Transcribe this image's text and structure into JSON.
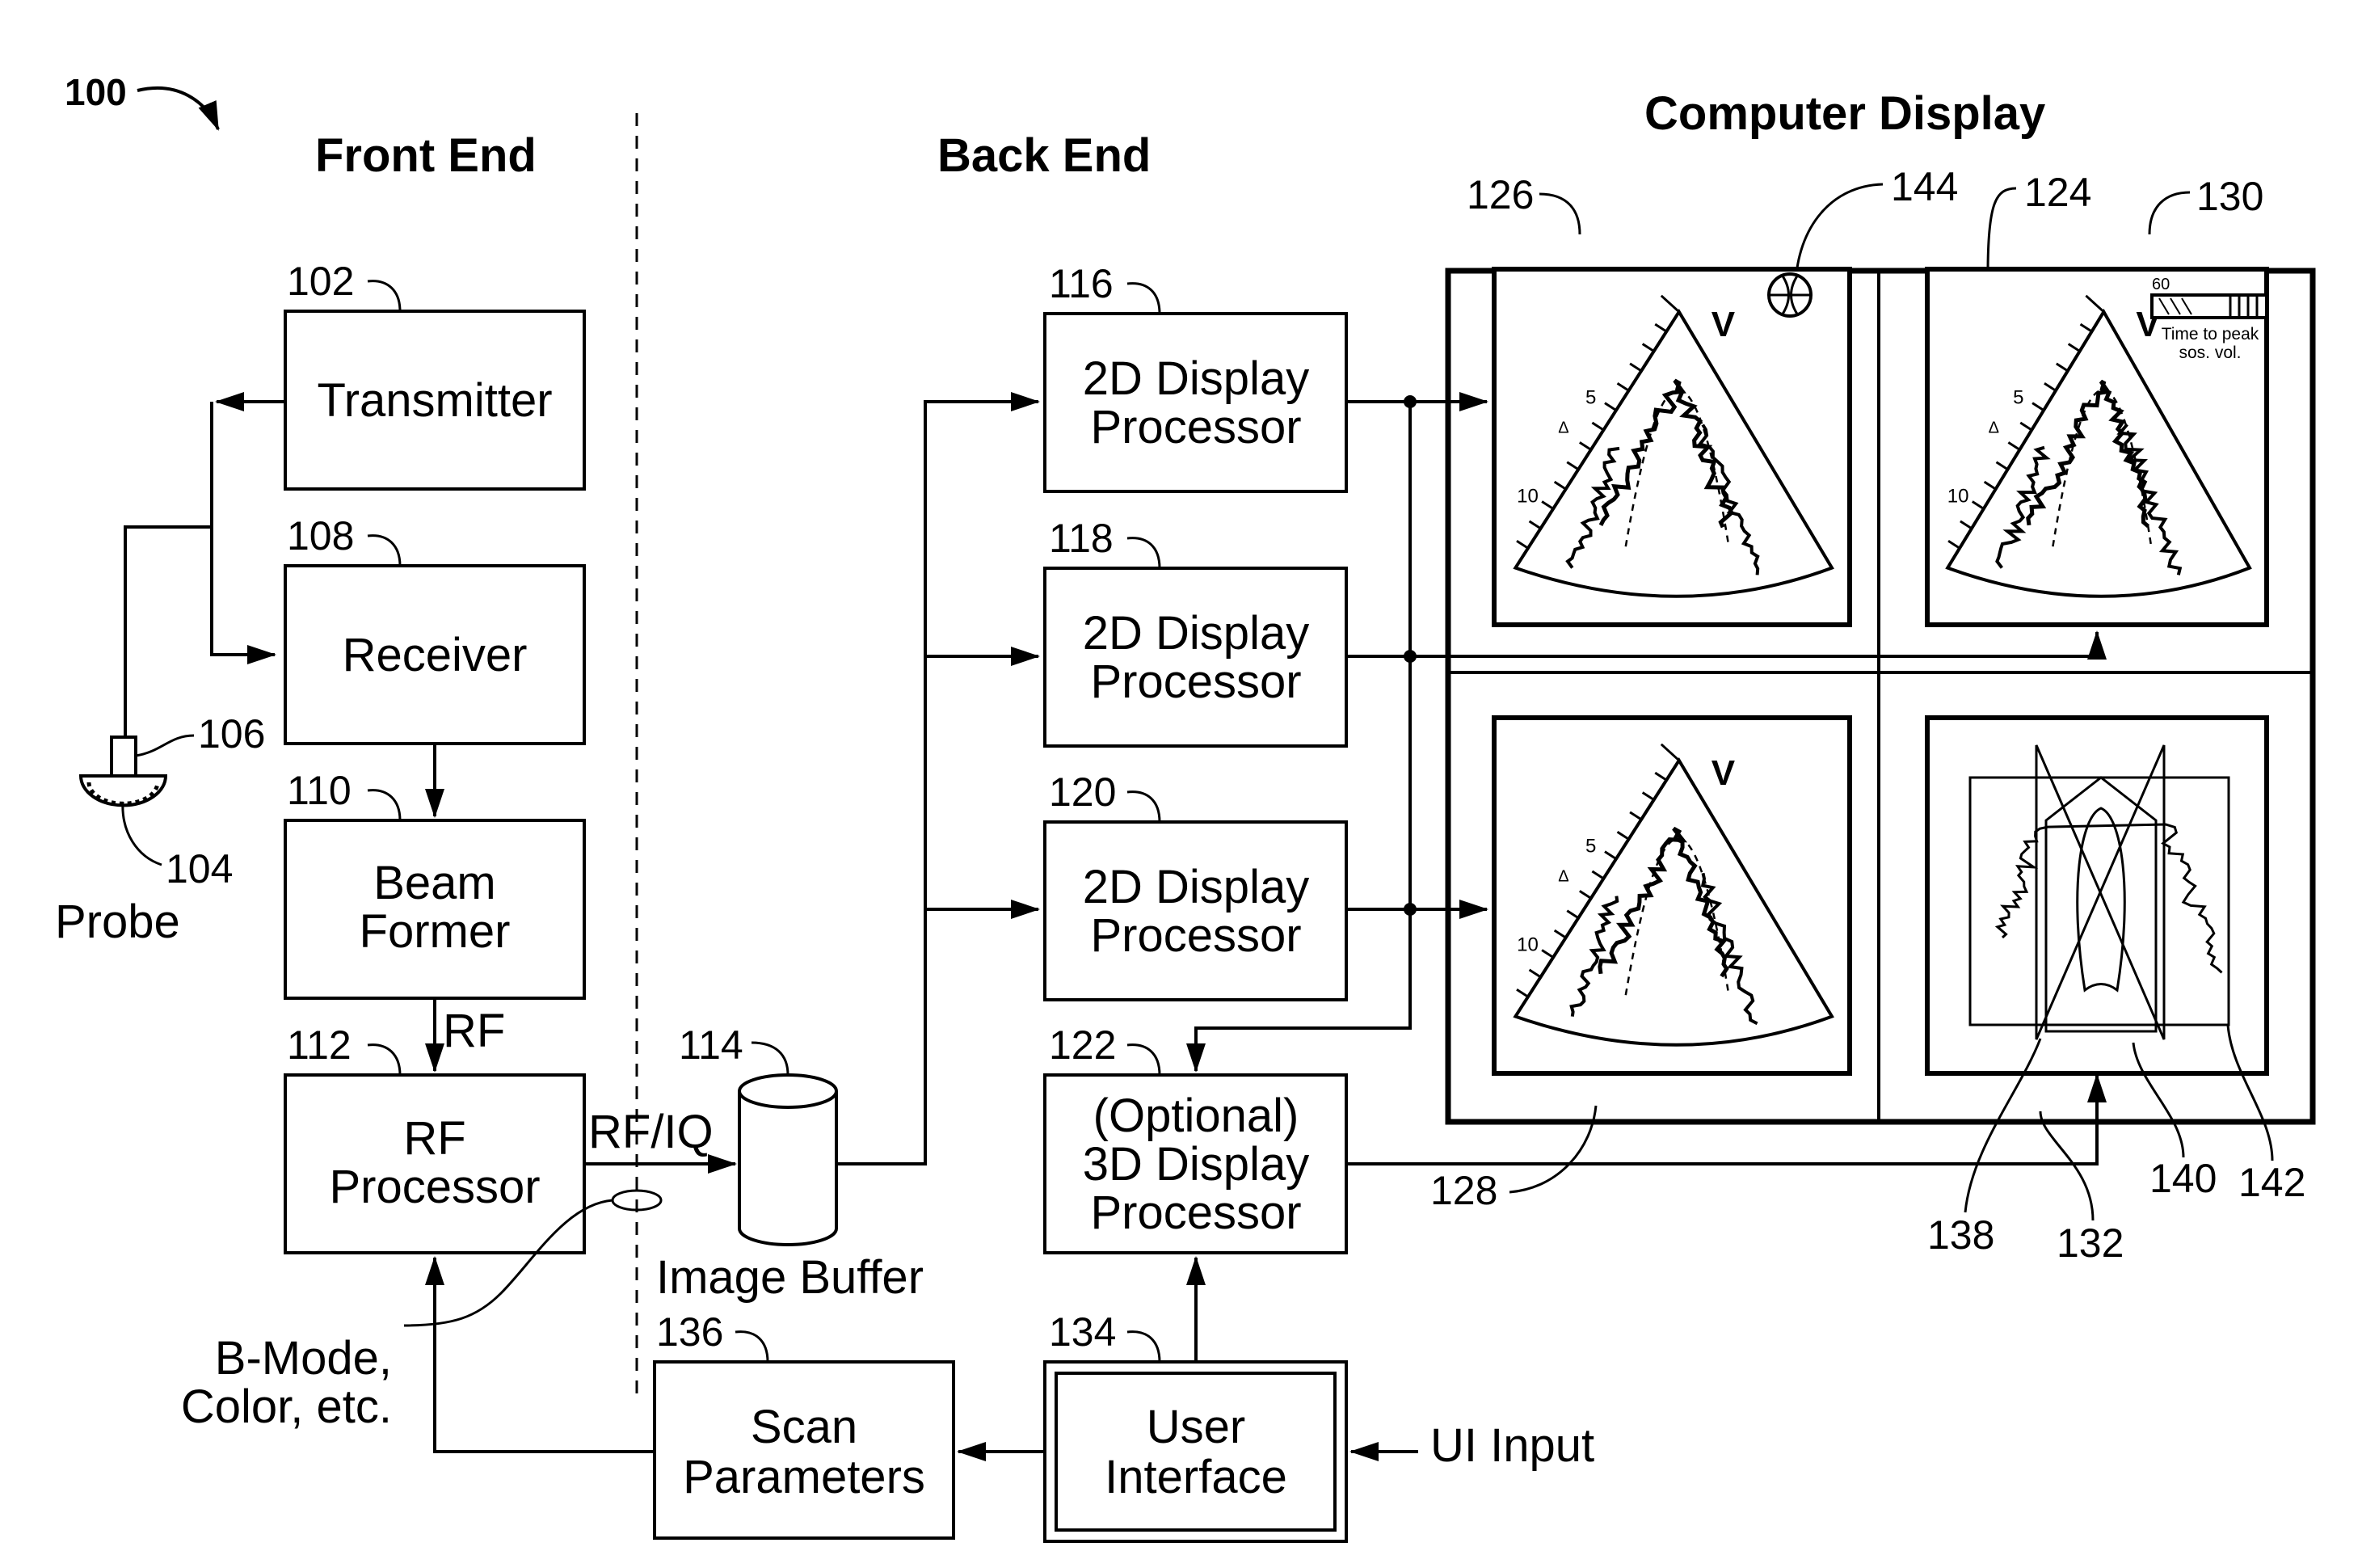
{
  "figure": {
    "ref": "100",
    "sections": {
      "front_end": "Front End",
      "back_end": "Back End",
      "computer_display": "Computer Display"
    }
  },
  "blocks": {
    "transmitter": {
      "ref": "102",
      "label": [
        "Transmitter"
      ]
    },
    "receiver": {
      "ref": "108",
      "label": [
        "Receiver"
      ]
    },
    "beam_former": {
      "ref": "110",
      "label": [
        "Beam",
        "Former"
      ]
    },
    "rf_processor": {
      "ref": "112",
      "label": [
        "RF",
        "Processor"
      ]
    },
    "image_buffer": {
      "ref": "114",
      "label": "Image Buffer"
    },
    "disp116": {
      "ref": "116",
      "label": [
        "2D Display",
        "Processor"
      ]
    },
    "disp118": {
      "ref": "118",
      "label": [
        "2D Display",
        "Processor"
      ]
    },
    "disp120": {
      "ref": "120",
      "label": [
        "2D Display",
        "Processor"
      ]
    },
    "disp122": {
      "ref": "122",
      "label": [
        "(Optional)",
        "3D Display",
        "Processor"
      ]
    },
    "user_interface": {
      "ref": "134",
      "label": [
        "User",
        "Interface"
      ]
    },
    "scan_parameters": {
      "ref": "136",
      "label": [
        "Scan",
        "Parameters"
      ]
    }
  },
  "probe": {
    "label": "Probe",
    "ref_cable": "106",
    "ref_array": "104"
  },
  "signals": {
    "rf": "RF",
    "rf_iq": "RF/IQ",
    "mode": [
      "B-Mode,",
      "Color, etc."
    ],
    "ui_input": "UI Input"
  },
  "display": {
    "refs": {
      "r124": "124",
      "r126": "126",
      "r128": "128",
      "r130": "130",
      "r132": "132",
      "r138": "138",
      "r140": "140",
      "r142": "142",
      "r144": "144"
    },
    "view_label": "V",
    "depth_ticks": [
      "5",
      "10"
    ],
    "marker": "Δ",
    "legend": {
      "value": "60",
      "caption": [
        "Time to peak",
        "sos. vol."
      ]
    }
  }
}
